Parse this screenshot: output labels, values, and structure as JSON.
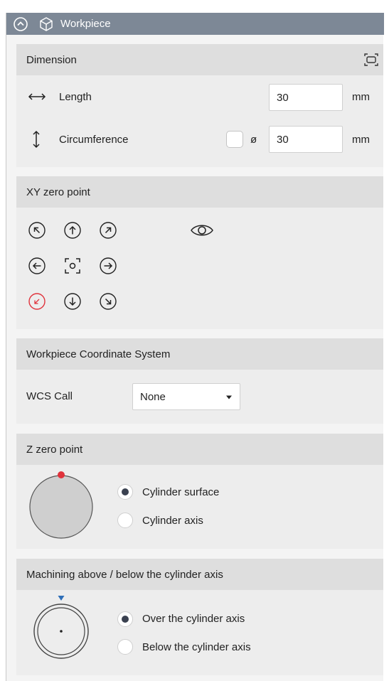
{
  "title": "Workpiece",
  "dimension": {
    "title": "Dimension",
    "length": {
      "label": "Length",
      "value": "30",
      "unit": "mm"
    },
    "circumference": {
      "label": "Circumference",
      "diameter_symbol": "ø",
      "value": "30",
      "unit": "mm",
      "diameter_checked": false
    }
  },
  "xy_zero": {
    "title": "XY zero point",
    "selected": "bottom-left"
  },
  "wcs": {
    "title": "Workpiece Coordinate System",
    "call_label": "WCS Call",
    "call_value": "None"
  },
  "z_zero": {
    "title": "Z zero point",
    "options": [
      {
        "label": "Cylinder surface",
        "selected": true
      },
      {
        "label": "Cylinder axis",
        "selected": false
      }
    ]
  },
  "machining": {
    "title": "Machining above / below the cylinder axis",
    "options": [
      {
        "label": "Over the cylinder axis",
        "selected": true
      },
      {
        "label": "Below the cylinder axis",
        "selected": false
      }
    ]
  },
  "colors": {
    "accent_red": "#e0333c",
    "title_bar": "#7d8896",
    "marker_blue": "#2f6fb8"
  }
}
